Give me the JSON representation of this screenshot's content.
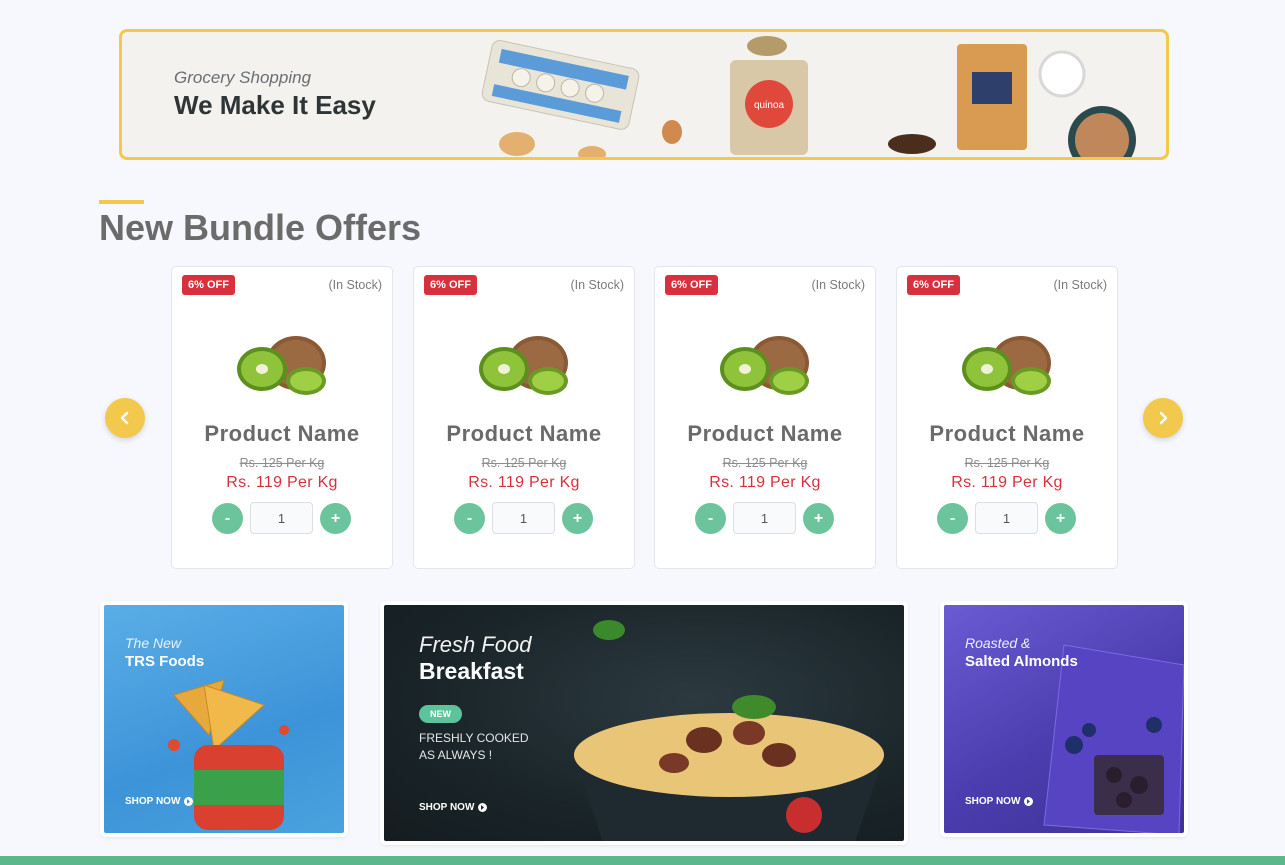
{
  "banner": {
    "subtitle": "Grocery Shopping",
    "title": "We Make It Easy",
    "package_label": "quinoa"
  },
  "section": {
    "title": "New Bundle Offers"
  },
  "carousel": {
    "prev_icon": "chevron-left-icon",
    "next_icon": "chevron-right-icon",
    "products": [
      {
        "badge": "6% OFF",
        "stock": "(In Stock)",
        "name": "Product Name",
        "old_price": "Rs. 125 Per Kg",
        "price": "Rs. 119 Per Kg",
        "qty": "1",
        "minus": "-",
        "plus": "+"
      },
      {
        "badge": "6% OFF",
        "stock": "(In Stock)",
        "name": "Product Name",
        "old_price": "Rs. 125 Per Kg",
        "price": "Rs. 119 Per Kg",
        "qty": "1",
        "minus": "-",
        "plus": "+"
      },
      {
        "badge": "6% OFF",
        "stock": "(In Stock)",
        "name": "Product Name",
        "old_price": "Rs. 125 Per Kg",
        "price": "Rs. 119 Per Kg",
        "qty": "1",
        "minus": "-",
        "plus": "+"
      },
      {
        "badge": "6% OFF",
        "stock": "(In Stock)",
        "name": "Product Name",
        "old_price": "Rs. 125 Per Kg",
        "price": "Rs. 119 Per Kg",
        "qty": "1",
        "minus": "-",
        "plus": "+"
      }
    ]
  },
  "promos": [
    {
      "italic": "The New",
      "bold": "TRS Foods",
      "cta": "SHOP NOW"
    },
    {
      "italic": "Fresh Food",
      "bold": "Breakfast",
      "badge": "NEW",
      "line1": "FRESHLY COOKED",
      "line2": "AS ALWAYS !",
      "cta": "SHOP NOW"
    },
    {
      "italic": "Roasted &",
      "bold": "Salted Almonds",
      "cta": "SHOP NOW"
    }
  ],
  "colors": {
    "accent": "#f2c94c",
    "green": "#6cc49c",
    "sale": "#d9303e",
    "footer": "#5cb88c"
  }
}
